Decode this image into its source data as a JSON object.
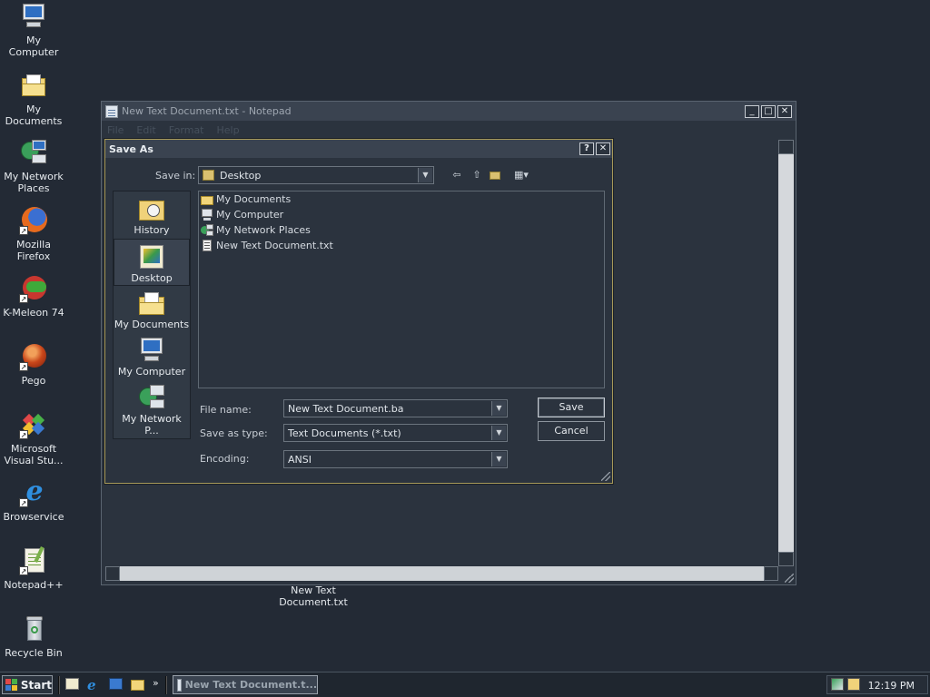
{
  "desktop": {
    "icons": [
      {
        "label": "My Computer",
        "icon": "computer-icon"
      },
      {
        "label": "My Documents",
        "icon": "folder-icon"
      },
      {
        "label": "My Network Places",
        "icon": "network-icon"
      },
      {
        "label": "Mozilla Firefox",
        "icon": "firefox-icon"
      },
      {
        "label": "K-Meleon 74",
        "icon": "kmeleon-icon"
      },
      {
        "label": "Pego",
        "icon": "pego-icon"
      },
      {
        "label": "Microsoft Visual Stu...",
        "icon": "visual-studio-icon"
      },
      {
        "label": "Browservice",
        "icon": "ie-icon"
      },
      {
        "label": "Notepad++",
        "icon": "notepadpp-icon"
      },
      {
        "label": "Recycle Bin",
        "icon": "recycle-bin-icon"
      }
    ],
    "file_label": "New Text Document.txt"
  },
  "notepad": {
    "title": "New Text Document.txt - Notepad",
    "menu": [
      "File",
      "Edit",
      "Format",
      "Help"
    ]
  },
  "dialog": {
    "title": "Save As",
    "save_in_label": "Save in:",
    "save_in_value": "Desktop",
    "places": [
      "History",
      "Desktop",
      "My Documents",
      "My Computer",
      "My Network P..."
    ],
    "selected_place": "Desktop",
    "files": [
      {
        "name": "My Documents",
        "icon": "folder-icon"
      },
      {
        "name": "My Computer",
        "icon": "computer-icon"
      },
      {
        "name": "My Network Places",
        "icon": "network-icon"
      },
      {
        "name": "New Text Document.txt",
        "icon": "text-file-icon"
      }
    ],
    "file_name_label": "File name:",
    "file_name_value": "New Text Document.ba",
    "save_as_type_label": "Save as type:",
    "save_as_type_value": "Text Documents (*.txt)",
    "encoding_label": "Encoding:",
    "encoding_value": "ANSI",
    "save_button": "Save",
    "cancel_button": "Cancel"
  },
  "taskbar": {
    "start_label": "Start",
    "task_label": "New Text Document.t...",
    "clock": "12:19 PM"
  }
}
